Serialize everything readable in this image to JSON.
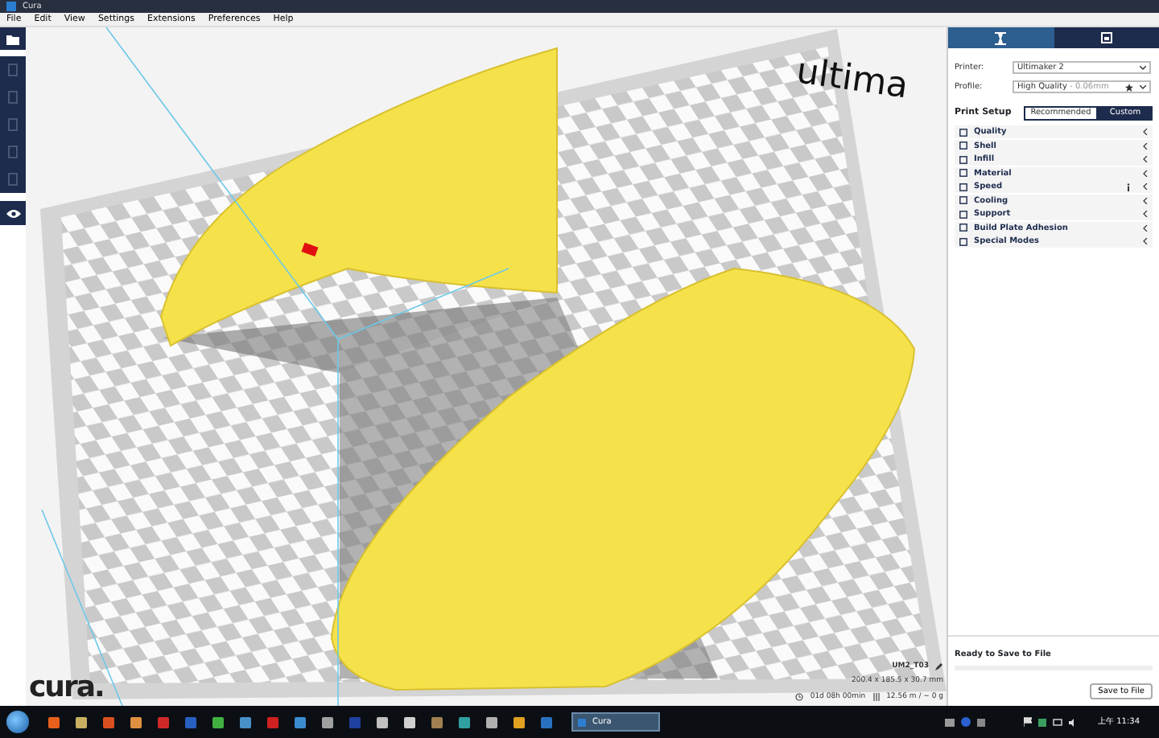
{
  "window": {
    "title": "Cura"
  },
  "menu": [
    {
      "label": "File"
    },
    {
      "label": "Edit"
    },
    {
      "label": "View"
    },
    {
      "label": "Settings"
    },
    {
      "label": "Extensions"
    },
    {
      "label": "Preferences"
    },
    {
      "label": "Help"
    }
  ],
  "viewport": {
    "wall_text": "ultima"
  },
  "panel": {
    "tabs": [
      {
        "kind": "print",
        "selected": true
      },
      {
        "kind": "monitor",
        "selected": false
      }
    ],
    "printer": {
      "label": "Printer:",
      "value": "Ultimaker 2"
    },
    "profile": {
      "label": "Profile:",
      "value": "High Quality",
      "detail": "- 0.06mm"
    },
    "print_setup": {
      "label": "Print Setup",
      "modes": [
        {
          "label": "Recommended",
          "selected": false
        },
        {
          "label": "Custom",
          "selected": true
        }
      ]
    },
    "categories": [
      {
        "label": "Quality",
        "info": false
      },
      {
        "label": "Shell",
        "info": false
      },
      {
        "label": "Infill",
        "info": false
      },
      {
        "label": "Material",
        "info": false
      },
      {
        "label": "Speed",
        "info": true
      },
      {
        "label": "Cooling",
        "info": false
      },
      {
        "label": "Support",
        "info": false
      },
      {
        "label": "Build Plate Adhesion",
        "info": false
      },
      {
        "label": "Special Modes",
        "info": false
      }
    ],
    "save": {
      "status": "Ready to Save to File",
      "level": 0,
      "button": "Save to File"
    }
  },
  "job": {
    "name": "UM2_T03",
    "dimensions": "200.4 x 185.5 x 30.7 mm",
    "time": "01d 08h 00min",
    "material": "12.56 m / ~ 0 g"
  },
  "logo": "cura.",
  "taskbar": {
    "apps": [
      {
        "color": "#e8601c"
      },
      {
        "color": "#c8b060"
      },
      {
        "color": "#d85020"
      },
      {
        "color": "#e09040"
      },
      {
        "color": "#d02828"
      },
      {
        "color": "#2860c0"
      },
      {
        "color": "#40b040"
      },
      {
        "color": "#4890c8"
      },
      {
        "color": "#d02020"
      },
      {
        "color": "#3c8cd0"
      },
      {
        "color": "#a0a0a0"
      },
      {
        "color": "#2040a0"
      },
      {
        "color": "#c0c0c0"
      },
      {
        "color": "#d0d0d0"
      },
      {
        "color": "#a08050"
      },
      {
        "color": "#30a0a0"
      },
      {
        "color": "#b0b0b0"
      },
      {
        "color": "#e0a020"
      },
      {
        "color": "#2a70c0"
      }
    ],
    "task": {
      "label": "Cura"
    },
    "clock": "上午 11:34"
  }
}
